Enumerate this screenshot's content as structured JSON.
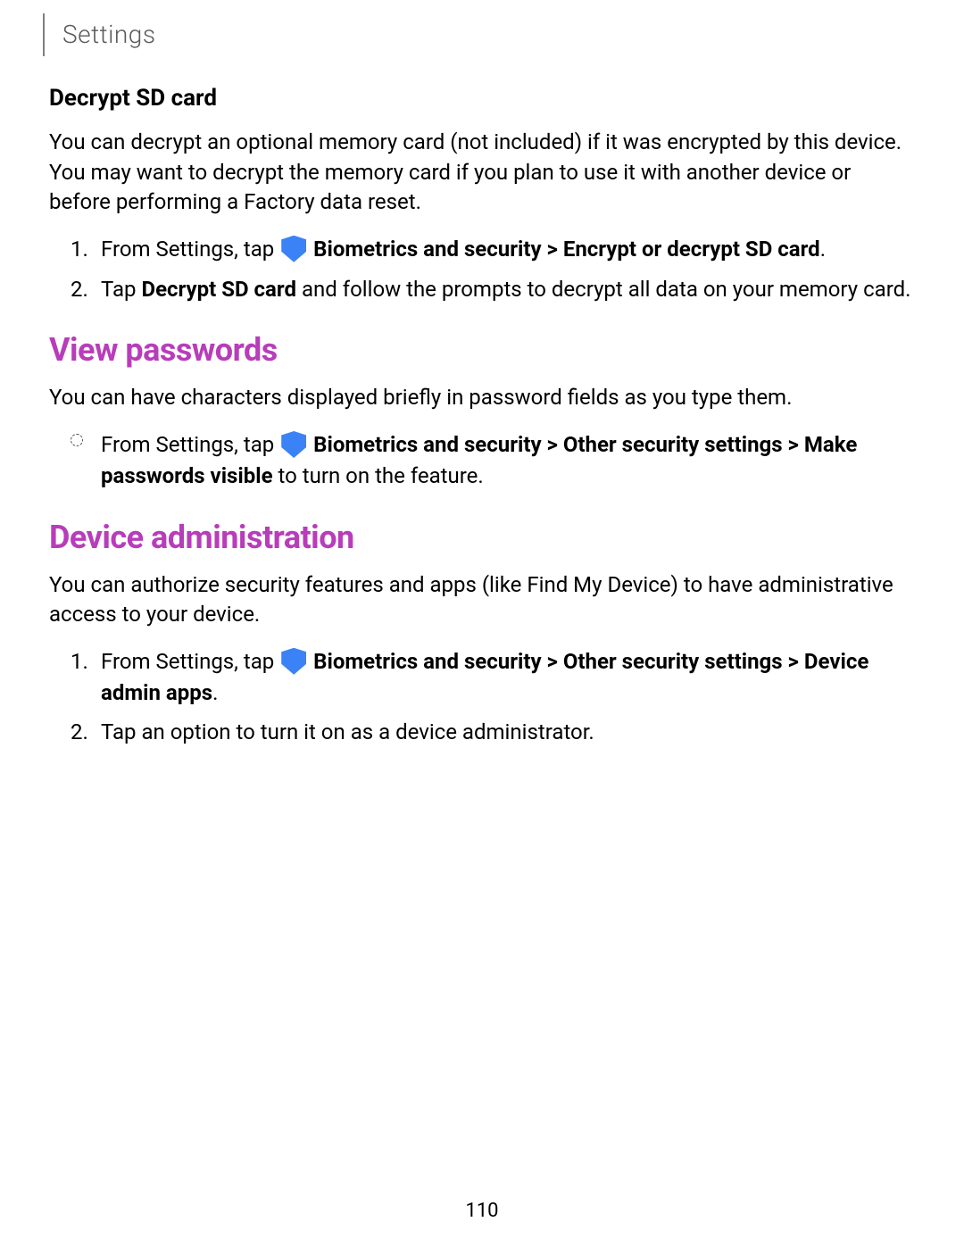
{
  "header": {
    "breadcrumb": "Settings"
  },
  "sections": {
    "decrypt": {
      "heading": "Decrypt SD card",
      "body": "You can decrypt an optional memory card (not included) if it was encrypted by this device. You may want to decrypt the memory card if you plan to use it with another device or before performing a Factory data reset.",
      "step1_prefix": "From Settings, tap ",
      "step1_bold": "Biometrics and security > Encrypt or decrypt SD card",
      "step1_suffix": ".",
      "step2_prefix": "Tap ",
      "step2_bold": "Decrypt SD card",
      "step2_suffix": " and follow the prompts to decrypt all data on your memory card."
    },
    "viewpw": {
      "heading": "View passwords",
      "body": "You can have characters displayed briefly in password fields as you type them.",
      "step1_prefix": "From Settings, tap ",
      "step1_bold1": "Biometrics and security > Other security settings > Make passwords visible",
      "step1_suffix": " to turn on the feature."
    },
    "devadmin": {
      "heading": "Device administration",
      "body": "You can authorize security features and apps (like Find My Device) to have administrative access to your device.",
      "step1_prefix": "From Settings, tap ",
      "step1_bold": "Biometrics and security > Other security settings > Device admin apps",
      "step1_suffix": ".",
      "step2": "Tap an option to turn it on as a device administrator."
    }
  },
  "list_numbers": {
    "one": "1.",
    "two": "2."
  },
  "page_number": "110"
}
